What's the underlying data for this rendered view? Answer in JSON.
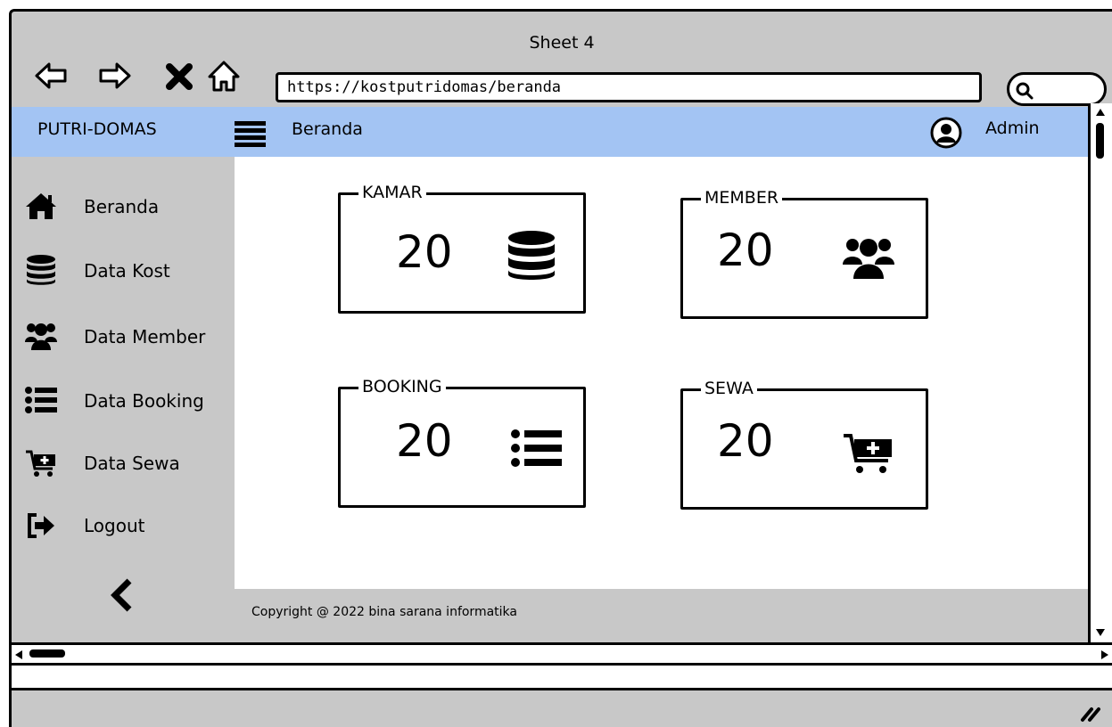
{
  "window": {
    "title": "Sheet 4"
  },
  "browser": {
    "url": "https://kostputridomas/beranda",
    "nav_icons": [
      "back-arrow-icon",
      "forward-arrow-icon",
      "close-icon",
      "home-icon"
    ]
  },
  "header": {
    "brand": "PUTRI-DOMAS",
    "page": "Beranda",
    "user": "Admin"
  },
  "sidebar": {
    "items": [
      {
        "label": "Beranda",
        "icon": "home-icon"
      },
      {
        "label": "Data Kost",
        "icon": "database-icon"
      },
      {
        "label": "Data Member",
        "icon": "users-icon"
      },
      {
        "label": "Data Booking",
        "icon": "list-icon"
      },
      {
        "label": "Data Sewa",
        "icon": "cart-plus-icon"
      },
      {
        "label": "Logout",
        "icon": "sign-out-icon"
      }
    ],
    "collapse_icon": "chevron-left-icon"
  },
  "cards": [
    {
      "title": "KAMAR",
      "value": "20",
      "icon": "database-icon"
    },
    {
      "title": "MEMBER",
      "value": "20",
      "icon": "users-icon"
    },
    {
      "title": "BOOKING",
      "value": "20",
      "icon": "list-icon"
    },
    {
      "title": "SEWA",
      "value": "20",
      "icon": "cart-plus-icon"
    }
  ],
  "footer": {
    "copyright": "Copyright @ 2022 bina sarana informatika"
  },
  "colors": {
    "header_bg": "#a3c4f3",
    "chrome_bg": "#c8c8c8"
  }
}
